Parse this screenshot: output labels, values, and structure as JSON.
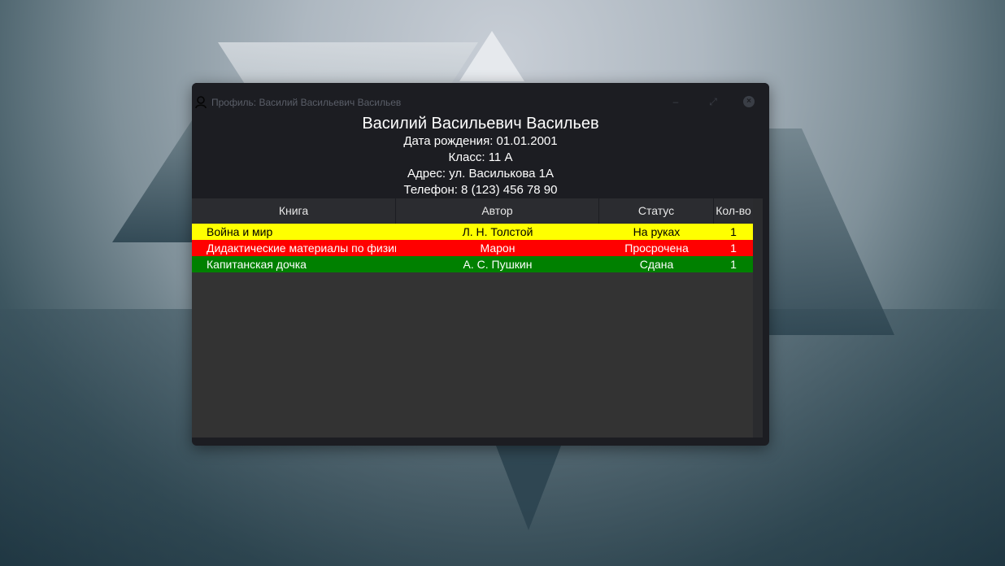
{
  "window": {
    "title": "Профиль: Василий Васильевич Васильев"
  },
  "profile": {
    "name": "Василий Васильевич Васильев",
    "birth_date": "Дата рождения: 01.01.2001",
    "class": "Класс: 11 А",
    "address": "Адрес: ул. Василькова 1А",
    "phone": "Телефон: 8 (123) 456 78 90"
  },
  "table": {
    "columns": [
      "Книга",
      "Автор",
      "Статус",
      "Кол-во"
    ],
    "rows": [
      {
        "book": "Война и мир",
        "author": "Л. Н. Толстой",
        "status": "На руках",
        "count": "1",
        "color": "#ffff00"
      },
      {
        "book": "Дидактические материалы по физике",
        "author": "Марон",
        "status": "Просрочена",
        "count": "1",
        "color": "#ff0000"
      },
      {
        "book": "Капитанская дочка",
        "author": "А. С. Пушкин",
        "status": "Сдана",
        "count": "1",
        "color": "#008000"
      }
    ]
  },
  "icons": {
    "window": "user-icon",
    "minimize": "minimize-icon",
    "maximize": "maximize-icon",
    "close": "close-icon"
  }
}
